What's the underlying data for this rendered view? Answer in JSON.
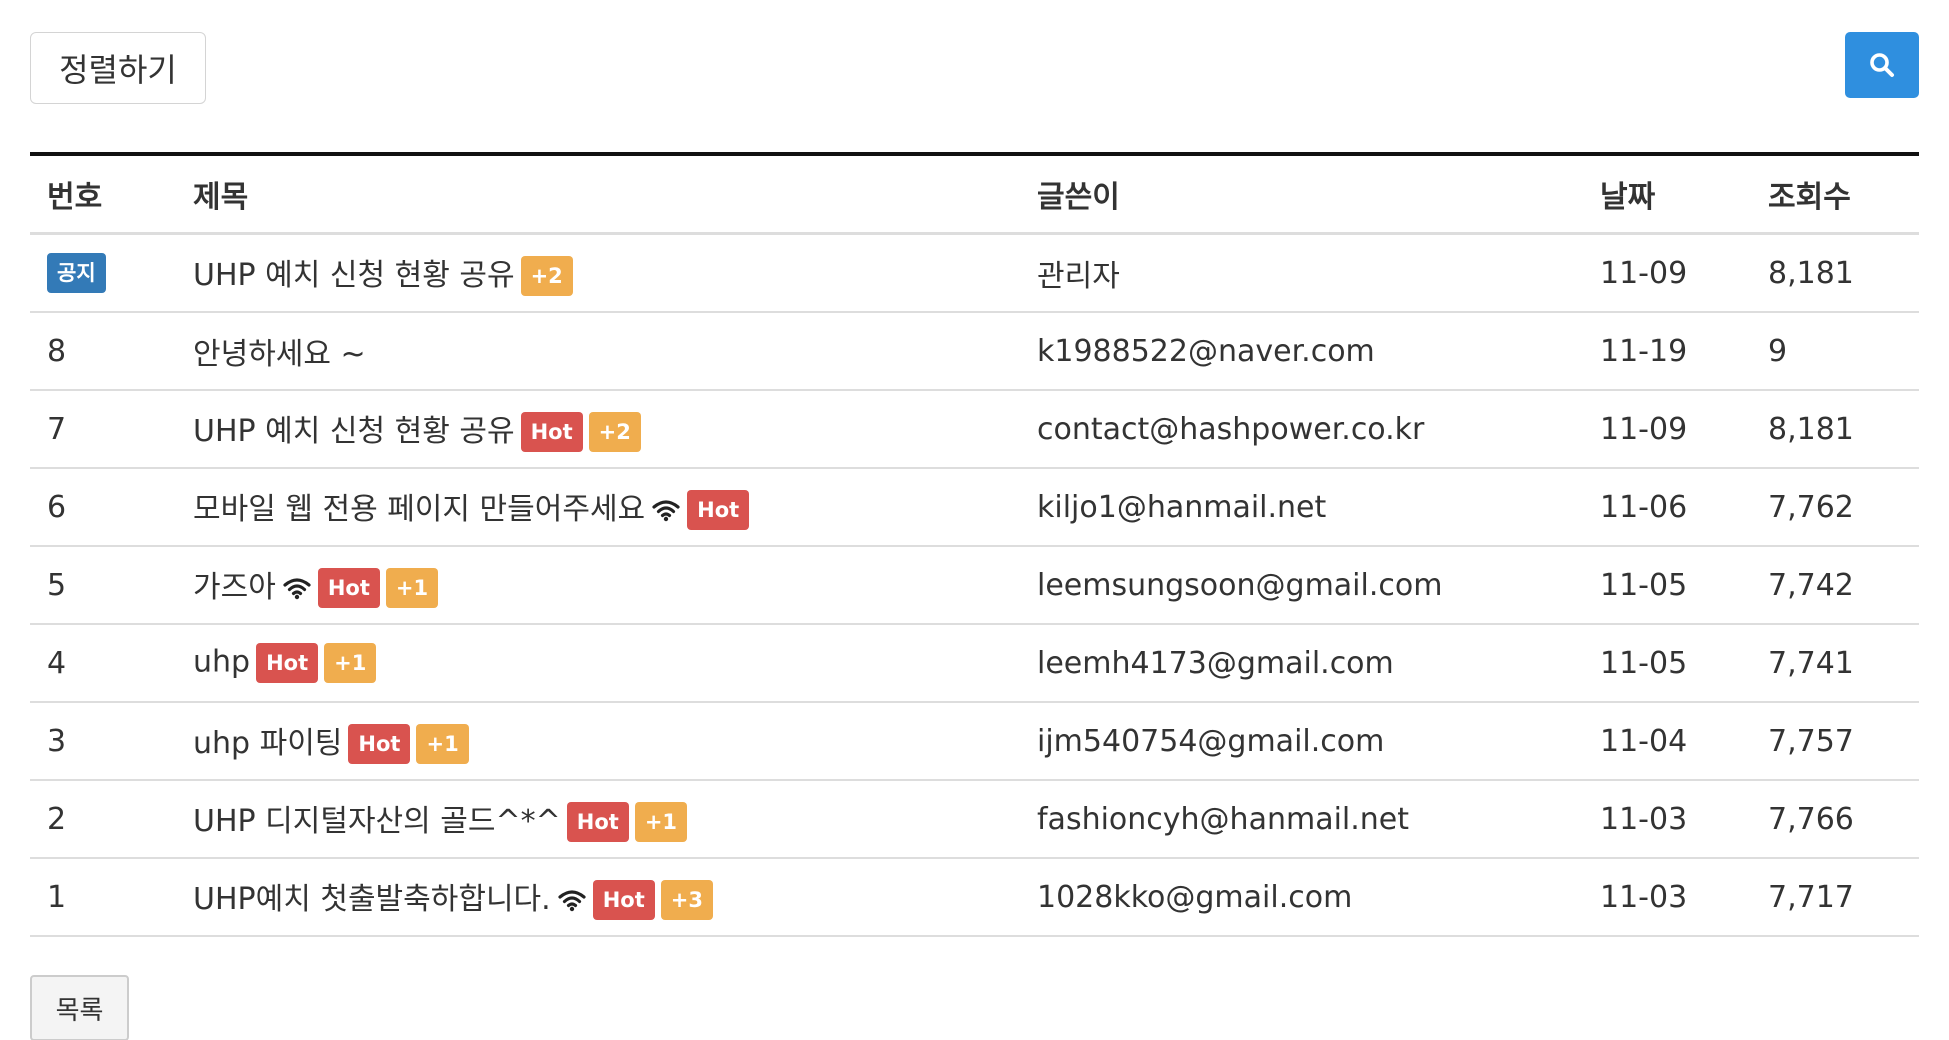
{
  "toolbar": {
    "sort_label": "정렬하기",
    "search_icon": "search-icon",
    "search_color": "#2f8fdf"
  },
  "table": {
    "headers": {
      "no": "번호",
      "title": "제목",
      "author": "글쓴이",
      "date": "날짜",
      "views": "조회수"
    },
    "rows": [
      {
        "no": "",
        "notice": "공지",
        "title": "UHP 예치 신청 현황 공유",
        "wifi": false,
        "hot": "",
        "count": "+2",
        "author": "관리자",
        "date": "11-09",
        "views": "8,181"
      },
      {
        "no": "8",
        "notice": "",
        "title": "안녕하세요 ~",
        "wifi": false,
        "hot": "",
        "count": "",
        "author": "k1988522@naver.com",
        "date": "11-19",
        "views": "9"
      },
      {
        "no": "7",
        "notice": "",
        "title": "UHP 예치 신청 현황 공유",
        "wifi": false,
        "hot": "Hot",
        "count": "+2",
        "author": "contact@hashpower.co.kr",
        "date": "11-09",
        "views": "8,181"
      },
      {
        "no": "6",
        "notice": "",
        "title": "모바일 웹 전용 페이지 만들어주세요",
        "wifi": true,
        "hot": "Hot",
        "count": "",
        "author": "kiljo1@hanmail.net",
        "date": "11-06",
        "views": "7,762"
      },
      {
        "no": "5",
        "notice": "",
        "title": "가즈아",
        "wifi": true,
        "hot": "Hot",
        "count": "+1",
        "author": "leemsungsoon@gmail.com",
        "date": "11-05",
        "views": "7,742"
      },
      {
        "no": "4",
        "notice": "",
        "title": "uhp",
        "wifi": false,
        "hot": "Hot",
        "count": "+1",
        "author": "leemh4173@gmail.com",
        "date": "11-05",
        "views": "7,741"
      },
      {
        "no": "3",
        "notice": "",
        "title": "uhp 파이팅",
        "wifi": false,
        "hot": "Hot",
        "count": "+1",
        "author": "ijm540754@gmail.com",
        "date": "11-04",
        "views": "7,757"
      },
      {
        "no": "2",
        "notice": "",
        "title": "UHP 디지털자산의 골드^*^",
        "wifi": false,
        "hot": "Hot",
        "count": "+1",
        "author": "fashioncyh@hanmail.net",
        "date": "11-03",
        "views": "7,766"
      },
      {
        "no": "1",
        "notice": "",
        "title": "UHP예치 첫출발축하합니다.",
        "wifi": true,
        "hot": "Hot",
        "count": "+3",
        "author": "1028kko@gmail.com",
        "date": "11-03",
        "views": "7,717"
      }
    ]
  },
  "footer": {
    "list_label": "목록"
  },
  "colors": {
    "notice": "#337ab7",
    "hot": "#d9534f",
    "count": "#f0ad4e"
  }
}
